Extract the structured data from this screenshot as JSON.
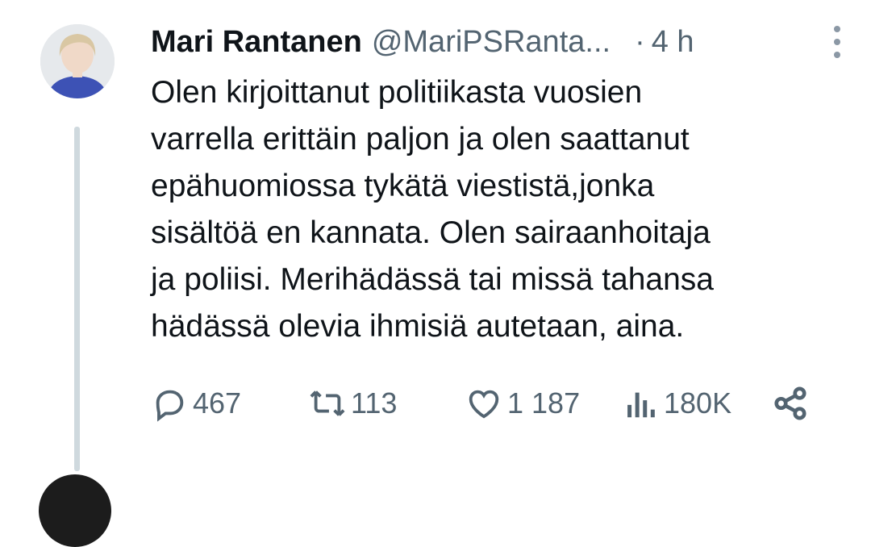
{
  "tweet": {
    "author_name": "Mari Rantanen",
    "handle": "@MariPSRanta...",
    "separator": "·",
    "time": "4 h",
    "text": "Olen kirjoittanut politiikasta vuosien\nvarrella erittäin paljon ja olen saattanut\nepähuomiossa tykätä viestistä,jonka\nsisältöä en kannata. Olen sairaanhoitaja\nja poliisi. Merihädässä tai missä tahansa\nhädässä olevia ihmisiä autetaan, aina.",
    "actions": {
      "replies": "467",
      "reposts": "113",
      "likes": "1 187",
      "views": "180K"
    }
  },
  "icons": [
    "reply-icon",
    "repost-icon",
    "like-icon",
    "views-icon",
    "share-icon",
    "more-icon"
  ],
  "colors": {
    "text": "#0f1419",
    "muted": "#536471",
    "thread_line": "#cfd9de",
    "avatar_dress": "#3d52b5"
  }
}
